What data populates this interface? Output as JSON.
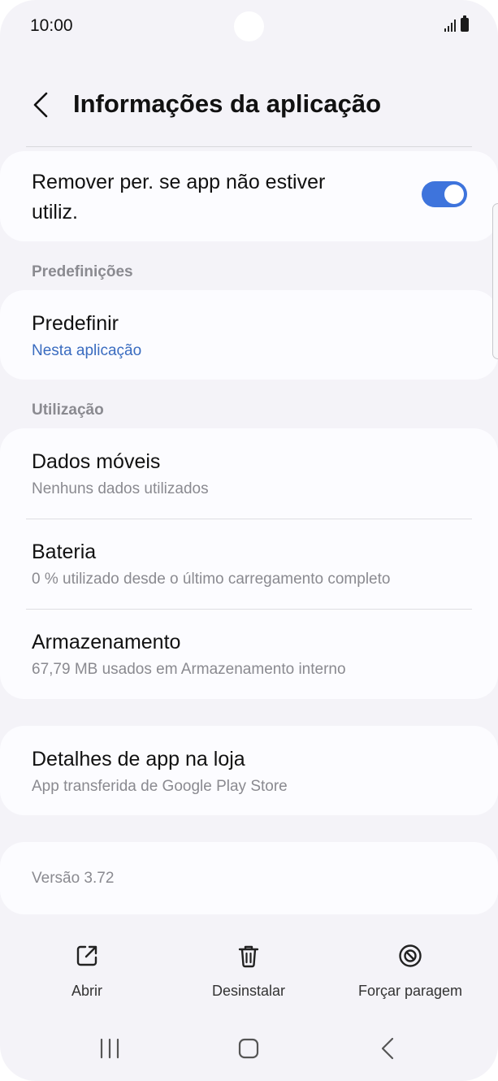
{
  "status_bar": {
    "time": "10:00"
  },
  "header": {
    "title": "Informações da aplicação"
  },
  "remove_permissions": {
    "label": "Remover per. se app não estiver utiliz.",
    "enabled": true
  },
  "sections": {
    "defaults_label": "Predefinições",
    "usage_label": "Utilização"
  },
  "defaults": {
    "title": "Predefinir",
    "subtitle": "Nesta aplicação"
  },
  "usage": [
    {
      "title": "Dados móveis",
      "subtitle": "Nenhuns dados utilizados"
    },
    {
      "title": "Bateria",
      "subtitle": "0 % utilizado desde o último carregamento completo"
    },
    {
      "title": "Armazenamento",
      "subtitle": "67,79 MB usados em Armazenamento interno"
    }
  ],
  "store": {
    "title": "Detalhes de app na loja",
    "subtitle": "App transferida de Google Play Store"
  },
  "version": "Versão 3.72",
  "actions": {
    "open": "Abrir",
    "uninstall": "Desinstalar",
    "force_stop": "Forçar paragem"
  },
  "colors": {
    "accent": "#3e74dc",
    "link": "#3a6cc0",
    "background": "#f4f3f8",
    "card": "#fcfcff"
  },
  "icons": {
    "back": "chevron-left-icon",
    "open": "external-link-icon",
    "uninstall": "trash-icon",
    "force_stop": "stop-circle-icon",
    "nav_recents": "recents-icon",
    "nav_home": "home-icon",
    "nav_back": "nav-back-icon"
  }
}
